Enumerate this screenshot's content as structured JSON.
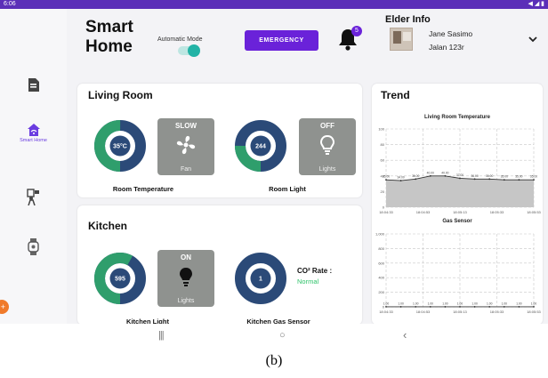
{
  "status_bar": {
    "time": "6:06",
    "right": "◀ ◢ ▮"
  },
  "nav": {
    "items": [
      {
        "icon": "document-icon",
        "label": ""
      },
      {
        "icon": "smart-home-icon",
        "label": "Smart Home"
      },
      {
        "icon": "person-device-icon",
        "label": ""
      },
      {
        "icon": "watch-icon",
        "label": ""
      }
    ],
    "active_color": "#6a3ce0"
  },
  "header": {
    "title_line1": "Smart",
    "title_line2": "Home",
    "auto_mode_label": "Automatic Mode",
    "auto_mode_on": true,
    "emergency_label": "EMERGENCY",
    "notification_count": "5"
  },
  "elder": {
    "title": "Elder Info",
    "name": "Jane Sasimo",
    "address": "Jalan 123r"
  },
  "living_room": {
    "title": "Living Room",
    "temperature": {
      "value": "35°C",
      "fraction": 0.5,
      "caption": "Room Temperature"
    },
    "fan": {
      "state": "SLOW",
      "label": "Fan"
    },
    "light": {
      "value": "244",
      "fraction": 0.25,
      "caption": "Room Light"
    },
    "lights_tile": {
      "state": "OFF",
      "label": "Lights"
    }
  },
  "kitchen": {
    "title": "Kitchen",
    "light": {
      "value": "595",
      "fraction": 0.58,
      "caption": "Kitchen Light"
    },
    "lights_tile": {
      "state": "ON",
      "label": "Lights"
    },
    "gas": {
      "value": "1",
      "fraction": 0.0,
      "caption": "Kitchen Gas Sensor"
    },
    "co2_label": "CO² Rate :",
    "co2_status": "Normal"
  },
  "trend": {
    "title": "Trend"
  },
  "colors": {
    "donut_fill": "#2f9e6c",
    "donut_track": "#2b4a78",
    "donut_center": "#2b4a78",
    "emergency": "#6a22d9",
    "co2_normal": "#2fc36a"
  },
  "chart_data": [
    {
      "type": "area",
      "title": "Living Room Temperature",
      "x": [
        "18:04:33",
        "18:04:53",
        "18:05:13",
        "18:05:33",
        "18:05:53"
      ],
      "y_ticks": [
        "0",
        "20",
        "40",
        "60",
        "80",
        "100"
      ],
      "ylim": [
        0,
        100
      ],
      "values": [
        35,
        34,
        36,
        40,
        40,
        37,
        36,
        36,
        35,
        35,
        35
      ],
      "point_labels": [
        "35.00",
        "34.00",
        "36.00",
        "40.00",
        "40.00",
        "37.00",
        "36.00",
        "36.00",
        "35.00",
        "35.00",
        "35.00"
      ],
      "grid": true
    },
    {
      "type": "line",
      "title": "Gas Sensor",
      "x": [
        "18:04:33",
        "18:04:53",
        "18:05:13",
        "18:05:33",
        "18:05:53"
      ],
      "y_ticks": [
        "0",
        "200",
        "400",
        "600",
        "800",
        "1,000"
      ],
      "ylim": [
        0,
        1000
      ],
      "values": [
        1,
        1,
        1,
        1,
        1,
        1,
        1,
        1,
        1,
        1,
        1
      ],
      "point_labels": [
        "1.00",
        "1.00",
        "1.00",
        "1.00",
        "1.00",
        "1.00",
        "1.00",
        "1.00",
        "1.00",
        "1.00",
        "1.00"
      ],
      "grid": true
    }
  ],
  "system_nav": {
    "recents": "|||",
    "home": "○",
    "back": "‹"
  },
  "figure_caption": "(b)"
}
